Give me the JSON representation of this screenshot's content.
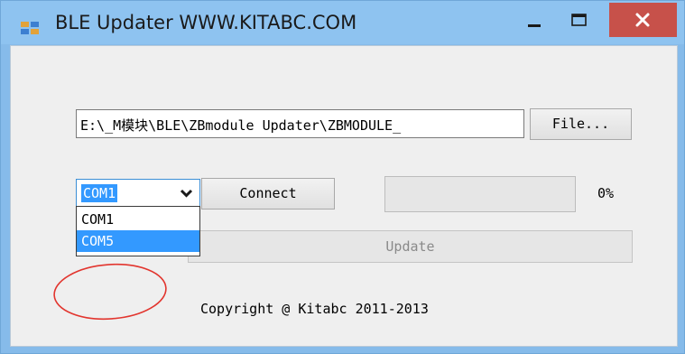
{
  "window": {
    "title": "BLE Updater WWW.KITABC.COM",
    "accent_color": "#86bbea",
    "close_color": "#c7514a"
  },
  "form": {
    "file_path": "E:\\_M模块\\BLE\\ZBmodule Updater\\ZBMODULE_",
    "file_button_label": "File...",
    "com_port": {
      "selected": "COM1",
      "options": [
        "COM1",
        "COM5"
      ],
      "highlighted": "COM5"
    },
    "connect_button_label": "Connect",
    "progress": {
      "percent_value": 0,
      "percent_text": "0%"
    },
    "update_button_label": "Update",
    "copyright": "Copyright @ Kitabc 2011-2013"
  },
  "icons": {
    "app": "app-window-icon",
    "minimize": "minimize-icon",
    "maximize": "maximize-icon",
    "close": "close-icon",
    "dropdown": "chevron-down-icon"
  },
  "annotation": {
    "shape": "ellipse",
    "color": "#e2352e",
    "target": "COM5"
  }
}
